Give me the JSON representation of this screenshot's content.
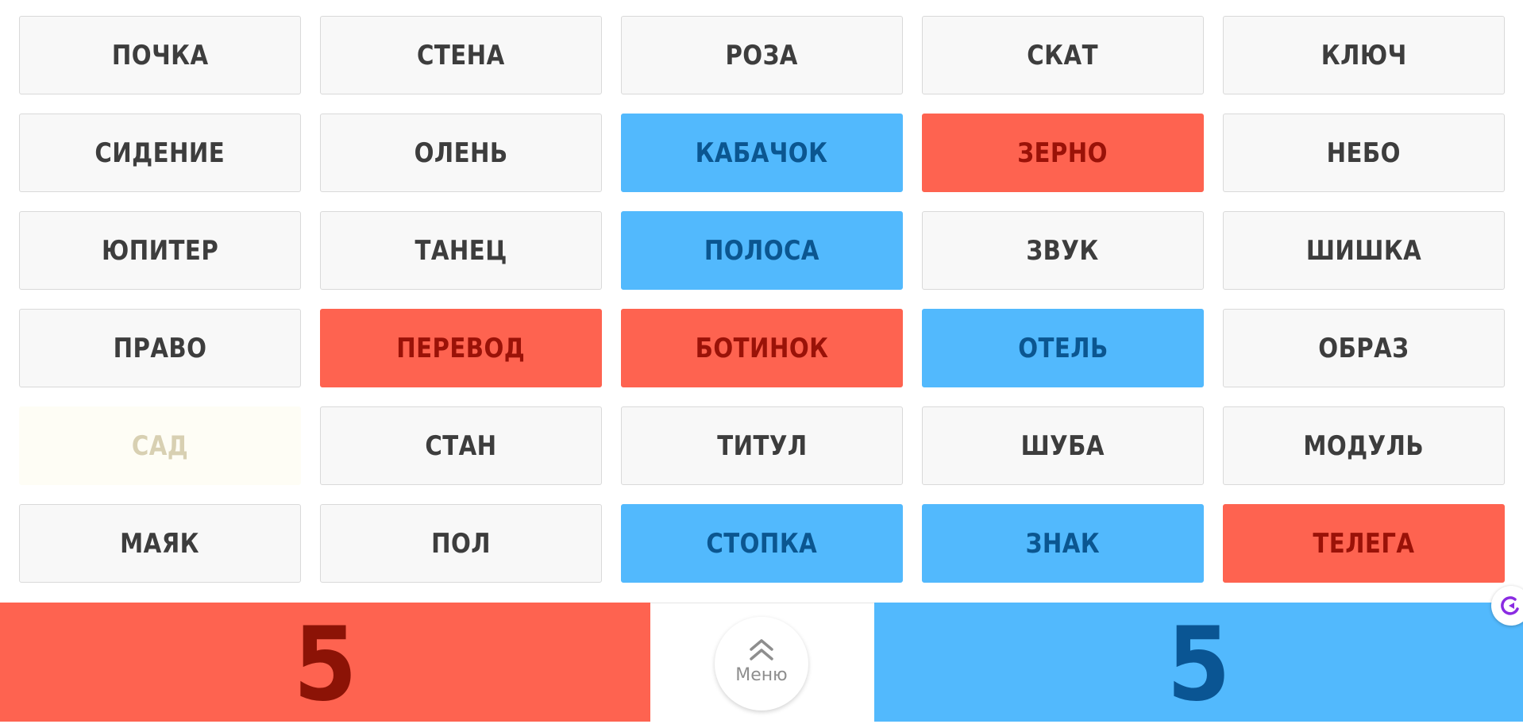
{
  "board": {
    "cards": [
      {
        "word": "ПОЧКА",
        "team": "none"
      },
      {
        "word": "СТЕНА",
        "team": "none"
      },
      {
        "word": "РОЗА",
        "team": "none"
      },
      {
        "word": "СКАТ",
        "team": "none"
      },
      {
        "word": "КЛЮЧ",
        "team": "none"
      },
      {
        "word": "СИДЕНИЕ",
        "team": "none"
      },
      {
        "word": "ОЛЕНЬ",
        "team": "none"
      },
      {
        "word": "КАБАЧОК",
        "team": "blue"
      },
      {
        "word": "ЗЕРНО",
        "team": "red"
      },
      {
        "word": "НЕБО",
        "team": "none"
      },
      {
        "word": "ЮПИТЕР",
        "team": "none"
      },
      {
        "word": "ТАНЕЦ",
        "team": "none"
      },
      {
        "word": "ПОЛОСА",
        "team": "blue"
      },
      {
        "word": "ЗВУК",
        "team": "none"
      },
      {
        "word": "ШИШКА",
        "team": "none"
      },
      {
        "word": "ПРАВО",
        "team": "none"
      },
      {
        "word": "ПЕРЕВОД",
        "team": "red"
      },
      {
        "word": "БОТИНОК",
        "team": "red"
      },
      {
        "word": "ОТЕЛЬ",
        "team": "blue"
      },
      {
        "word": "ОБРАЗ",
        "team": "none"
      },
      {
        "word": "САД",
        "team": "neutral"
      },
      {
        "word": "СТАН",
        "team": "none"
      },
      {
        "word": "ТИТУЛ",
        "team": "none"
      },
      {
        "word": "ШУБА",
        "team": "none"
      },
      {
        "word": "МОДУЛЬ",
        "team": "none"
      },
      {
        "word": "МАЯК",
        "team": "none"
      },
      {
        "word": "ПОЛ",
        "team": "none"
      },
      {
        "word": "СТОПКА",
        "team": "blue"
      },
      {
        "word": "ЗНАК",
        "team": "blue"
      },
      {
        "word": "ТЕЛЕГА",
        "team": "red"
      }
    ]
  },
  "scores": {
    "red": "5",
    "blue": "5"
  },
  "menu": {
    "label": "Меню",
    "icon": "double-chevron-up-icon"
  },
  "widget": {
    "icon": "assistant-widget-icon"
  },
  "colors": {
    "red_team": "#fe6350",
    "blue_team": "#52b9fd",
    "neutral": "#fefdf5",
    "unrevealed": "#f8f8f8"
  }
}
